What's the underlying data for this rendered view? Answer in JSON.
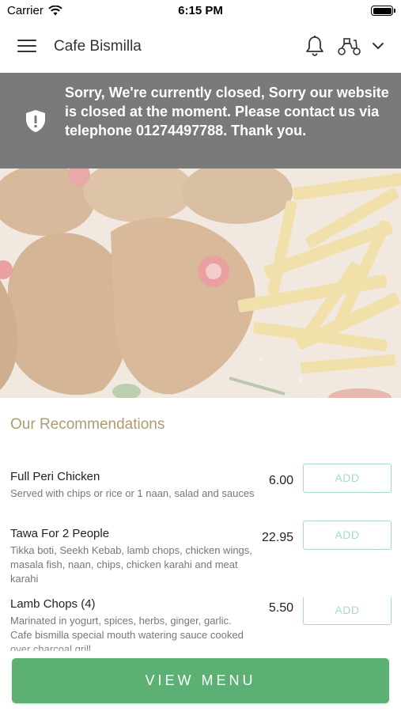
{
  "status_bar": {
    "carrier": "Carrier",
    "time": "6:15 PM"
  },
  "header": {
    "title": "Cafe Bismilla",
    "icons": [
      "menu-icon",
      "bell-icon",
      "scooter-icon",
      "chevron-down-icon"
    ]
  },
  "banner": {
    "icon": "shield-alert-icon",
    "message": "Sorry, We're currently closed, Sorry our website is closed at the moment. Please contact us via telephone 01274497788. Thank you.",
    "background_color": "#7a7a7a"
  },
  "recommendations": {
    "title": "Our Recommendations",
    "items": [
      {
        "name": "Full Peri Chicken",
        "description": "Served with chips or rice or 1 naan, salad and sauces",
        "price": "6.00",
        "add_label": "ADD"
      },
      {
        "name": "Tawa For 2 People",
        "description": "Tikka boti, Seekh Kebab, lamb chops, chicken wings, masala fish, naan, chips, chicken karahi and meat karahi",
        "price": "22.95",
        "add_label": "ADD"
      },
      {
        "name": "Lamb Chops (4)",
        "description": "Marinated in yogurt, spices, herbs, ginger, garlic. Cafe bismilla special mouth watering sauce cooked over charcoal grill",
        "price": "5.50",
        "add_label": "ADD"
      }
    ]
  },
  "footer": {
    "view_menu_label": "VIEW MENU"
  },
  "colors": {
    "accent": "#5db073",
    "section_title": "#b09a71",
    "add_border": "#a8dcc3"
  }
}
